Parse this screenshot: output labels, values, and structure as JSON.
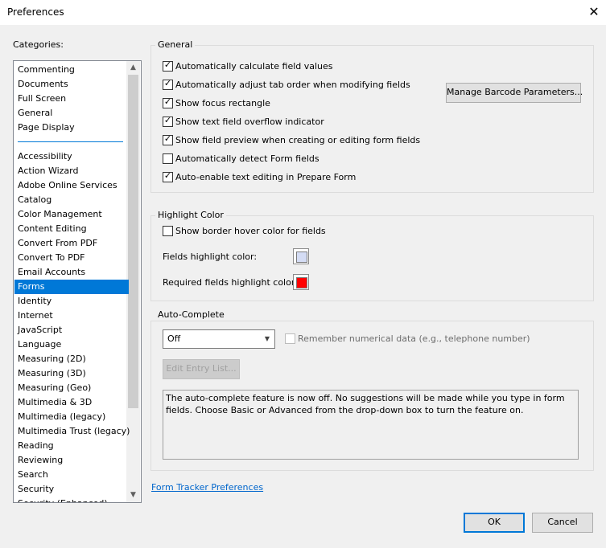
{
  "window": {
    "title": "Preferences",
    "close_glyph": "✕"
  },
  "categories": {
    "label": "Categories:",
    "top_items": [
      "Commenting",
      "Documents",
      "Full Screen",
      "General",
      "Page Display"
    ],
    "items": [
      "Accessibility",
      "Action Wizard",
      "Adobe Online Services",
      "Catalog",
      "Color Management",
      "Content Editing",
      "Convert From PDF",
      "Convert To PDF",
      "Email Accounts",
      "Forms",
      "Identity",
      "Internet",
      "JavaScript",
      "Language",
      "Measuring (2D)",
      "Measuring (3D)",
      "Measuring (Geo)",
      "Multimedia & 3D",
      "Multimedia (legacy)",
      "Multimedia Trust (legacy)",
      "Reading",
      "Reviewing",
      "Search",
      "Security",
      "Security (Enhanced)"
    ],
    "selected": "Forms"
  },
  "general": {
    "title": "General",
    "options": [
      {
        "label": "Automatically calculate field values",
        "checked": true
      },
      {
        "label": "Automatically adjust tab order when modifying fields",
        "checked": true
      },
      {
        "label": "Show focus rectangle",
        "checked": true
      },
      {
        "label": "Show text field overflow indicator",
        "checked": true
      },
      {
        "label": "Show field preview when creating or editing form fields",
        "checked": true
      },
      {
        "label": "Automatically detect Form fields",
        "checked": false
      },
      {
        "label": "Auto-enable text editing in Prepare Form",
        "checked": true
      }
    ],
    "barcode_button": "Manage Barcode Parameters..."
  },
  "highlight": {
    "title": "Highlight Color",
    "hover_label": "Show border hover color for fields",
    "hover_checked": false,
    "fields_label": "Fields highlight color:",
    "fields_color": "#d4dcf4",
    "required_label": "Required fields highlight color:",
    "required_color": "#ff0000"
  },
  "autocomplete": {
    "title": "Auto-Complete",
    "mode": "Off",
    "remember_label": "Remember numerical data (e.g., telephone number)",
    "edit_button": "Edit Entry List...",
    "description": "The auto-complete feature is now off. No suggestions will be made while you type in form fields. Choose Basic or Advanced from the drop-down box to turn the feature on."
  },
  "footer": {
    "link": "Form Tracker Preferences",
    "ok": "OK",
    "cancel": "Cancel"
  }
}
